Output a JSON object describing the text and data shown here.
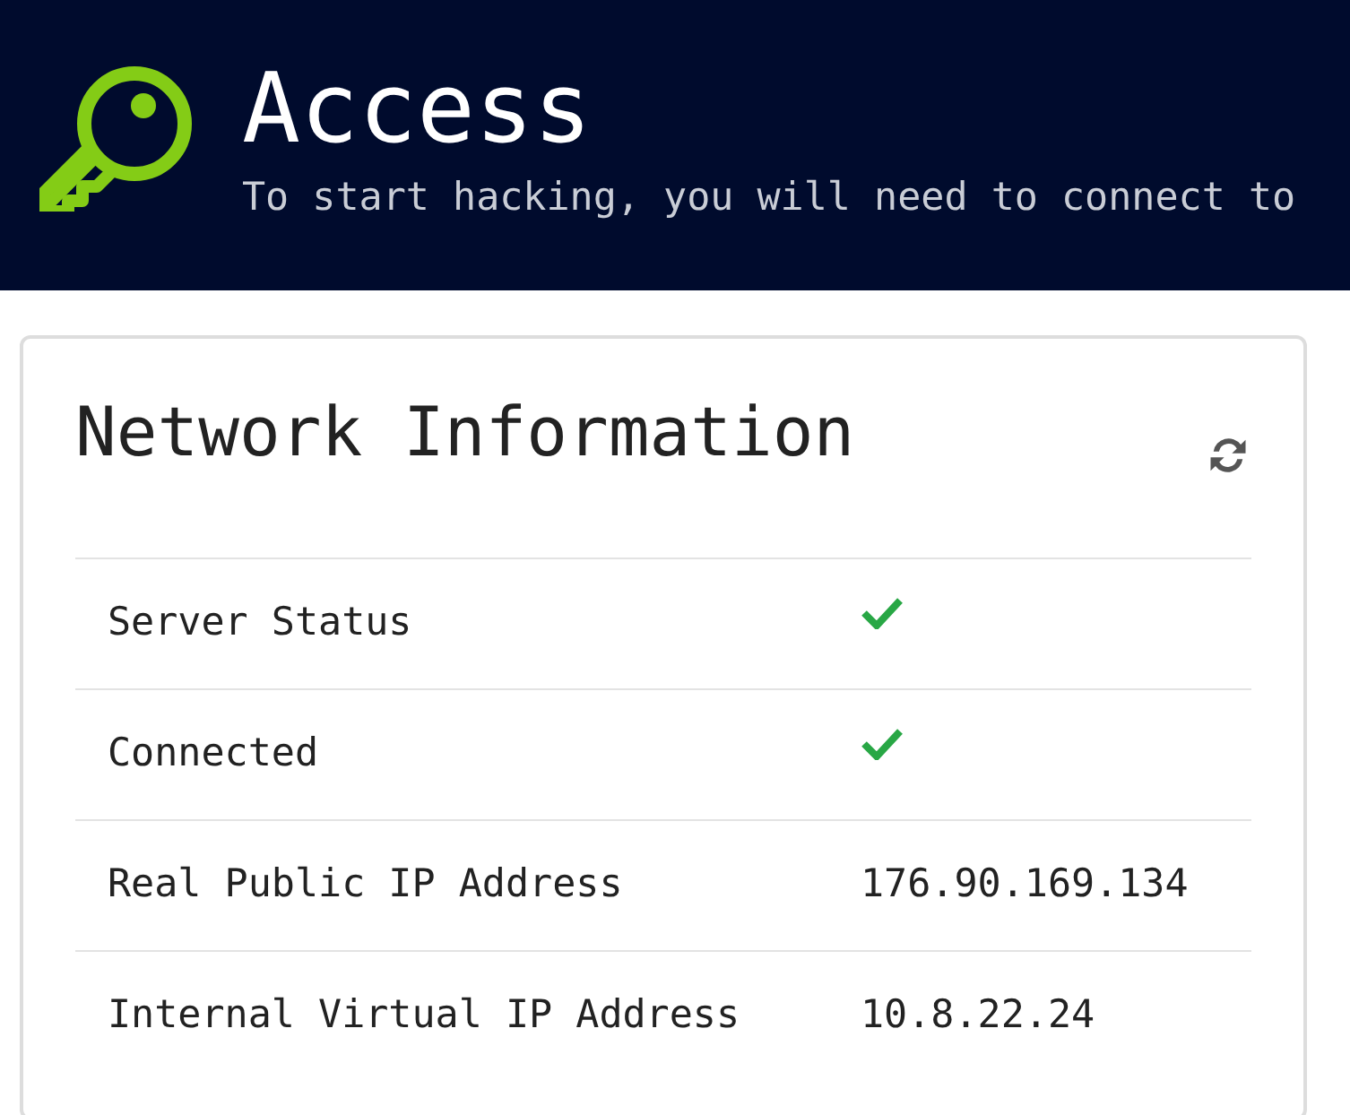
{
  "header": {
    "title": "Access",
    "subtitle": "To start hacking, you will need to connect to"
  },
  "card": {
    "title": "Network Information",
    "rows": [
      {
        "label": "Server Status",
        "kind": "check",
        "ok": true
      },
      {
        "label": "Connected",
        "kind": "check",
        "ok": true
      },
      {
        "label": "Real Public IP Address",
        "kind": "text",
        "value": "176.90.169.134"
      },
      {
        "label": "Internal Virtual IP Address",
        "kind": "text",
        "value": "10.8.22.24"
      }
    ]
  }
}
